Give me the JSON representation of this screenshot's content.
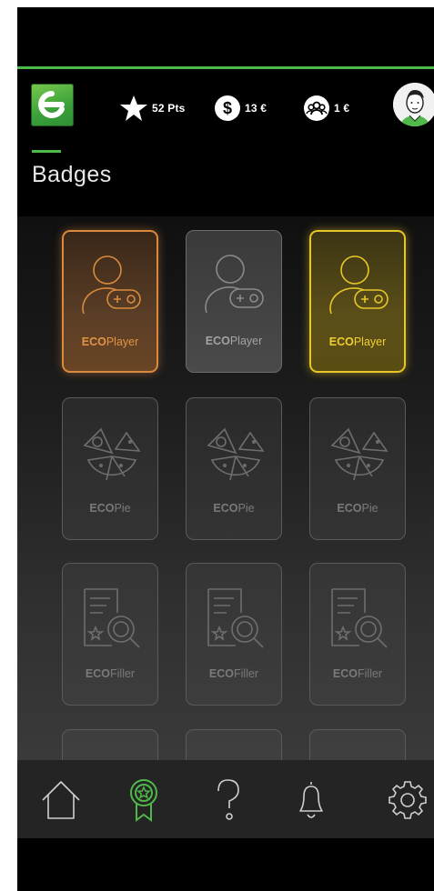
{
  "header": {
    "points": "52 Pts",
    "money": "13 €",
    "group_money": "1 €"
  },
  "page": {
    "title": "Badges"
  },
  "badges": [
    {
      "prefix": "ECO",
      "suffix": "Player",
      "tier": "bronze",
      "icon": "player-gamepad-icon"
    },
    {
      "prefix": "ECO",
      "suffix": "Player",
      "tier": "silver",
      "icon": "player-gamepad-icon"
    },
    {
      "prefix": "ECO",
      "suffix": "Player",
      "tier": "gold",
      "icon": "player-gamepad-icon"
    },
    {
      "prefix": "ECO",
      "suffix": "Pie",
      "tier": "locked",
      "icon": "pie-icon"
    },
    {
      "prefix": "ECO",
      "suffix": "Pie",
      "tier": "locked",
      "icon": "pie-icon"
    },
    {
      "prefix": "ECO",
      "suffix": "Pie",
      "tier": "locked",
      "icon": "pie-icon"
    },
    {
      "prefix": "ECO",
      "suffix": "Filler",
      "tier": "locked",
      "icon": "document-search-icon"
    },
    {
      "prefix": "ECO",
      "suffix": "Filler",
      "tier": "locked",
      "icon": "document-search-icon"
    },
    {
      "prefix": "ECO",
      "suffix": "Filler",
      "tier": "locked",
      "icon": "document-search-icon"
    }
  ],
  "nav": {
    "items": [
      {
        "icon": "home-icon",
        "active": false
      },
      {
        "icon": "badge-award-icon",
        "active": true
      },
      {
        "icon": "help-question-icon",
        "active": false
      },
      {
        "icon": "bell-icon",
        "active": false
      },
      {
        "icon": "gear-icon",
        "active": false
      }
    ]
  },
  "colors": {
    "brand_green": "#4fb848",
    "bronze": "#e39443",
    "gold": "#f0d030",
    "locked": "#7a7a7a"
  }
}
